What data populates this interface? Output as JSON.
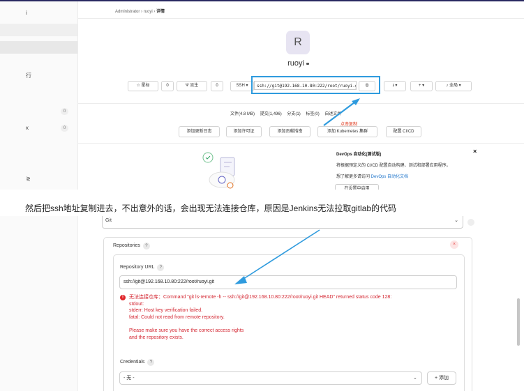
{
  "gitlab": {
    "breadcrumb": {
      "items": [
        "Administrator",
        "ruoyi",
        "详情"
      ],
      "separator": "›"
    },
    "sidebar": {
      "fragments": [
        "i",
        "行",
        "κ",
        "≷"
      ],
      "counts": [
        "0",
        "0"
      ]
    },
    "project": {
      "avatar_letter": "R",
      "name": "ruoyi"
    },
    "actions": {
      "star_label": "星标",
      "star_count": "0",
      "fork_label": "派生",
      "fork_count": "0",
      "ssh_label": "SSH",
      "ssh_url": "ssh://git@192.168.10.80:222/root/ruoyi.git",
      "notify_label": "全局"
    },
    "stats": {
      "files": "文件(4.8 MB)",
      "commits": "提交(1,496)",
      "branches": "分支(1)",
      "tags": "标签(0)",
      "readme": "自述文件"
    },
    "copy_hint": "点击复制",
    "add_buttons": [
      "添加更新日志",
      "添加许可证",
      "添加贡献指南",
      "添加 Kubernetes 集群",
      "配置 CI/CD"
    ],
    "devops": {
      "title": "DevOps 自动化(测试版)",
      "close": "×",
      "desc": "将根据预定义的 CI/CD 配置自动构建、测试和部署应用程序。",
      "learn_prefix": "想了解更多请访问 ",
      "learn_link": "DevOps 自动化文档",
      "button": "在设置中启用"
    }
  },
  "caption": "然后把ssh地址复制进去，不出意外的话，会出现无法连接仓库，原因是Jenkins无法拉取gitlab的代码",
  "jenkins": {
    "scm_select": "Git",
    "repositories_label": "Repositories",
    "help_mark": "?",
    "remove_mark": "×",
    "repo_url_label": "Repository URL",
    "repo_url": "ssh://git@192.168.10.80:222/root/ruoyi.git",
    "error_lines": [
      "无法连接仓库：Command \"git ls-remote -h -- ssh://git@192.168.10.80:222/root/ruoyi.git HEAD\" returned status code 128:",
      "stdout:",
      "stderr: Host key verification failed.",
      "fatal: Could not read from remote repository.",
      "",
      "Please make sure you have the correct access rights",
      "and the repository exists."
    ],
    "credentials_label": "Credentials",
    "credentials_value": "- 无 -",
    "add_button": "+ 添加"
  },
  "colors": {
    "highlight": "#2f9bde",
    "error": "#d3232e",
    "link": "#1f75cb"
  }
}
